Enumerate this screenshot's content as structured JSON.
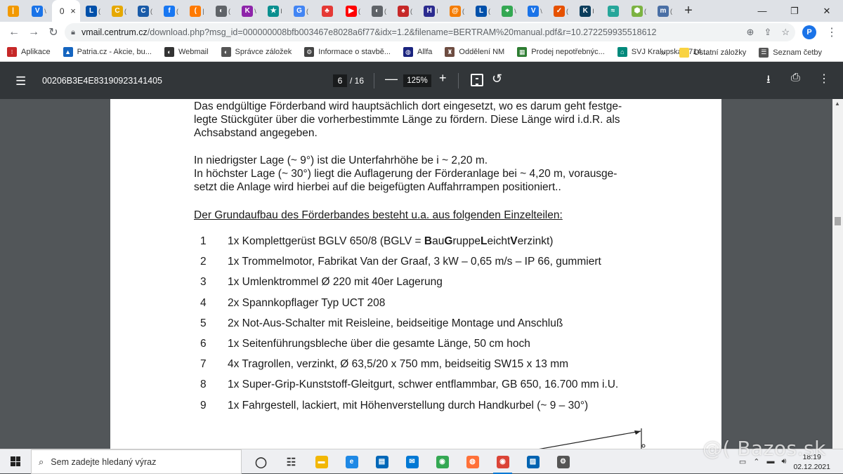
{
  "tabs": [
    {
      "fav": "|",
      "color": "#f29900",
      "letter": ""
    },
    {
      "fav": "V",
      "color": "#1a73e8",
      "letter": "\\"
    },
    {
      "fav": "0",
      "color": "",
      "letter": "",
      "active": true
    },
    {
      "fav": "L",
      "color": "#0050aa",
      "letter": "("
    },
    {
      "fav": "C",
      "color": "#e6a800",
      "letter": "("
    },
    {
      "fav": "C",
      "color": "#1a5ba8",
      "letter": "("
    },
    {
      "fav": "f",
      "color": "#1877f2",
      "letter": "("
    },
    {
      "fav": "(",
      "color": "#ff7a00",
      "letter": "|"
    },
    {
      "fav": "◐",
      "color": "#5f6368",
      "letter": "("
    },
    {
      "fav": "K",
      "color": "#8e24aa",
      "letter": "\\"
    },
    {
      "fav": "★",
      "color": "#0a8f8f",
      "letter": "I"
    },
    {
      "fav": "G",
      "color": "#4285f4",
      "letter": "("
    },
    {
      "fav": "♣",
      "color": "#e53935",
      "letter": ""
    },
    {
      "fav": "▶",
      "color": "#ff0000",
      "letter": "("
    },
    {
      "fav": "◐",
      "color": "#5f6368",
      "letter": "("
    },
    {
      "fav": "♠",
      "color": "#c62828",
      "letter": "("
    },
    {
      "fav": "H",
      "color": "#2b2b8f",
      "letter": "I"
    },
    {
      "fav": "@",
      "color": "#f57c00",
      "letter": "("
    },
    {
      "fav": "L",
      "color": "#0050aa",
      "letter": "("
    },
    {
      "fav": "⌖",
      "color": "#34a853",
      "letter": "\\"
    },
    {
      "fav": "V",
      "color": "#1a73e8",
      "letter": "\\"
    },
    {
      "fav": "✓",
      "color": "#e65100",
      "letter": "("
    },
    {
      "fav": "K",
      "color": "#0b3d5c",
      "letter": "I"
    },
    {
      "fav": "≈",
      "color": "#26a69a",
      "letter": ""
    },
    {
      "fav": "⬢",
      "color": "#7cb342",
      "letter": "("
    },
    {
      "fav": "m",
      "color": "#4a6fa5",
      "letter": "("
    }
  ],
  "active_tab_close": "×",
  "new_tab": "+",
  "window_controls": {
    "minimize": "—",
    "maximize": "❐",
    "close": "✕"
  },
  "nav": {
    "back": "←",
    "forward": "→",
    "reload": "↻"
  },
  "url": {
    "host": "vmail.centrum.cz",
    "path": "/download.php?msg_id=000000008bfb003467e8028a6f77&idx=1.2&filename=BERTRAM%20manual.pdf&r=10.272259935518612"
  },
  "omnibox_icons": {
    "zoom": "⊕",
    "share": "⇪",
    "star": "☆"
  },
  "profile_letter": "P",
  "menu": "⋮",
  "bookmarks": [
    {
      "label": "Aplikace",
      "color": "#c62828",
      "icon": "⁝"
    },
    {
      "label": "Patria.cz - Akcie, bu...",
      "color": "#1565c0",
      "icon": "▲"
    },
    {
      "label": "Webmail",
      "color": "#333333",
      "icon": "◐"
    },
    {
      "label": "Správce záložek",
      "color": "#555555",
      "icon": "◐"
    },
    {
      "label": "Informace o stavbě...",
      "color": "#444444",
      "icon": "⚙"
    },
    {
      "label": "Allfa",
      "color": "#1a237e",
      "icon": "◍"
    },
    {
      "label": "Oddělení NM",
      "color": "#6d4c41",
      "icon": "♜"
    },
    {
      "label": "Prodej nepotřebnýc...",
      "color": "#2e7d32",
      "icon": "▦"
    },
    {
      "label": "SVJ Kralupská 1714...",
      "color": "#00897b",
      "icon": "⌂"
    }
  ],
  "bookmarks_overflow": "»",
  "bookmarks_right": [
    {
      "label": "Ostatní záložky",
      "color": "#f9d342",
      "icon": ""
    },
    {
      "label": "Seznam četby",
      "color": "#555555",
      "icon": "☰"
    }
  ],
  "pdf": {
    "menu": "☰",
    "doc_name": "00206B3E4E83190923141405",
    "page_current": "6",
    "page_total": "/ 16",
    "zoom_minus": "—",
    "zoom_value": "125%",
    "zoom_plus": "+",
    "rotate": "↺",
    "download": "⭳",
    "print": "⎙",
    "more": "⋮"
  },
  "document": {
    "paragraph1": [
      "Das endgültige Förderband wird hauptsächlich dort eingesetzt, wo es darum geht festge-",
      "legte Stückgüter über die vorherbestimmte Länge zu fördern. Diese Länge wird i.d.R. als",
      "Achsabstand angegeben."
    ],
    "paragraph2": [
      "In niedrigster Lage (~ 9°) ist die Unterfahrhöhe be i ~ 2,20 m.",
      "In höchster Lage (~ 30°) liegt die Auflagerung der  Förderanlage bei ~ 4,20 m, vorausge-",
      "setzt die Anlage wird hierbei auf die beigefügten Auffahrrampen positioniert.."
    ],
    "heading": "Der Grundaufbau des Förderbandes besteht u.a. aus folgenden Einzelteilen:",
    "item1_prefix": "1x Komplettgerüst BGLV 650/8 (BGLV = ",
    "item1_b1": "B",
    "item1_t1": "au",
    "item1_b2": "G",
    "item1_t2": "ruppe",
    "item1_b3": "L",
    "item1_t3": "eicht",
    "item1_b4": "V",
    "item1_t4": "erzinkt)",
    "items": [
      {
        "num": "1",
        "text": ""
      },
      {
        "num": "2",
        "text": "1x Trommelmotor, Fabrikat Van der Graaf, 3 kW – 0,65 m/s – IP 66, gummiert"
      },
      {
        "num": "3",
        "text": "1x Umlenktrommel Ø 220 mit 40er Lagerung"
      },
      {
        "num": "4",
        "text": "2x Spannkopflager Typ UCT 208"
      },
      {
        "num": "5",
        "text": "2x Not-Aus-Schalter mit Reisleine, beidseitige Montage und Anschluß"
      },
      {
        "num": "6",
        "text": "1x Seitenführungsbleche über die gesamte Länge, 50 cm hoch"
      },
      {
        "num": "7",
        "text": "4x Tragrollen, verzinkt, Ø 63,5/20 x 750 mm, beidseitig SW15 x 13 mm"
      },
      {
        "num": "8",
        "text": "1x Super-Grip-Kunststoff-Gleitgurt, schwer entflammbar, GB 650, 16.700 mm i.U."
      },
      {
        "num": "9",
        "text": "1x Fahrgestell, lackiert, mit Höhenverstellung durch Handkurbel (~ 9 – 30°)"
      }
    ]
  },
  "taskbar": {
    "search_placeholder": "Sem zadejte hledaný výraz",
    "search_icon": "⌕",
    "apps": [
      {
        "name": "task-view",
        "icon": "◯",
        "color": "#333333"
      },
      {
        "name": "widgets",
        "icon": "☷",
        "color": "#333333"
      },
      {
        "name": "file-explorer",
        "icon": "▬",
        "color": "#f2b705"
      },
      {
        "name": "edge",
        "icon": "e",
        "color": "#1e88e5"
      },
      {
        "name": "store",
        "icon": "▤",
        "color": "#0067b8"
      },
      {
        "name": "mail",
        "icon": "✉",
        "color": "#0078d4"
      },
      {
        "name": "chrome",
        "icon": "◉",
        "color": "#34a853"
      },
      {
        "name": "firefox",
        "icon": "◍",
        "color": "#ff7139"
      },
      {
        "name": "chrome-profile",
        "icon": "◉",
        "color": "#db4437",
        "running": true
      },
      {
        "name": "photos",
        "icon": "▨",
        "color": "#0063b1"
      },
      {
        "name": "settings",
        "icon": "⚙",
        "color": "#555555"
      }
    ],
    "tray_icons": [
      "▭",
      "⌃",
      "▬",
      "🔊︎"
    ],
    "time": "18:19",
    "date": "02.12.2021"
  },
  "watermark": "@( Bazos.sk"
}
